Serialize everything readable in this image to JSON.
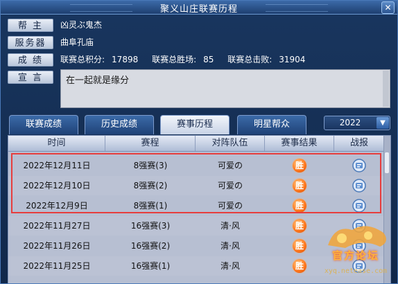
{
  "window": {
    "title": "聚义山庄联赛历程",
    "close_glyph": "✕"
  },
  "info": {
    "leader_label": "帮 主",
    "leader_value": "凶灵ぶ鬼杰",
    "server_label": "服务器",
    "server_value": "曲阜孔庙",
    "score_label": "成 绩",
    "total_points_label": "联赛总积分:",
    "total_points_value": "17898",
    "total_wins_label": "联赛总胜场:",
    "total_wins_value": "85",
    "total_kills_label": "联赛总击败:",
    "total_kills_value": "31904",
    "declaration_label": "宣 言",
    "declaration_value": "在一起就是缘分"
  },
  "tabs": [
    {
      "label": "联赛成绩",
      "active": false
    },
    {
      "label": "历史成绩",
      "active": false
    },
    {
      "label": "赛事历程",
      "active": true
    },
    {
      "label": "明星帮众",
      "active": false
    }
  ],
  "year_select": {
    "value": "2022",
    "arrow": "▼"
  },
  "table": {
    "headers": [
      "时间",
      "赛程",
      "对阵队伍",
      "赛事结果",
      "战报"
    ],
    "rows": [
      {
        "time": "2022年12月11日",
        "round": "8强赛(3)",
        "opponent": "可爱の",
        "result": "胜"
      },
      {
        "time": "2022年12月10日",
        "round": "8强赛(2)",
        "opponent": "可爱の",
        "result": "胜"
      },
      {
        "time": "2022年12月9日",
        "round": "8强赛(1)",
        "opponent": "可爱の",
        "result": "胜"
      },
      {
        "time": "2022年11月27日",
        "round": "16强赛(3)",
        "opponent": "清·风",
        "result": "胜"
      },
      {
        "time": "2022年11月26日",
        "round": "16强赛(2)",
        "opponent": "清·风",
        "result": "胜"
      },
      {
        "time": "2022年11月25日",
        "round": "16强赛(1)",
        "opponent": "清·风",
        "result": "胜"
      }
    ]
  },
  "watermark": {
    "line1": "官方论坛",
    "line2": "xyq.netease.com"
  }
}
